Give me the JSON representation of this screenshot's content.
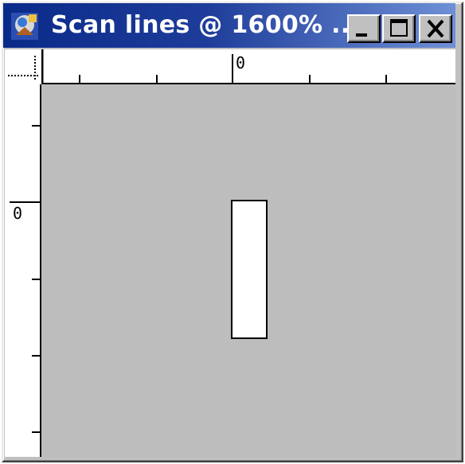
{
  "window": {
    "title": "Scan lines @ 1600% ...",
    "controls": {
      "minimize_label": "_",
      "maximize_label": "□",
      "close_label": "✕"
    }
  },
  "rulers": {
    "horizontal_origin_label": "0",
    "vertical_origin_label": "0"
  },
  "canvas": {
    "background_color": "#bdbdbd",
    "pixel_fill_color": "#ffffff",
    "pixel_border_color": "#000000"
  },
  "colors": {
    "titlebar_start": "#0a2a8a",
    "titlebar_end": "#6f8fd6",
    "chrome": "#c0c0c0"
  }
}
